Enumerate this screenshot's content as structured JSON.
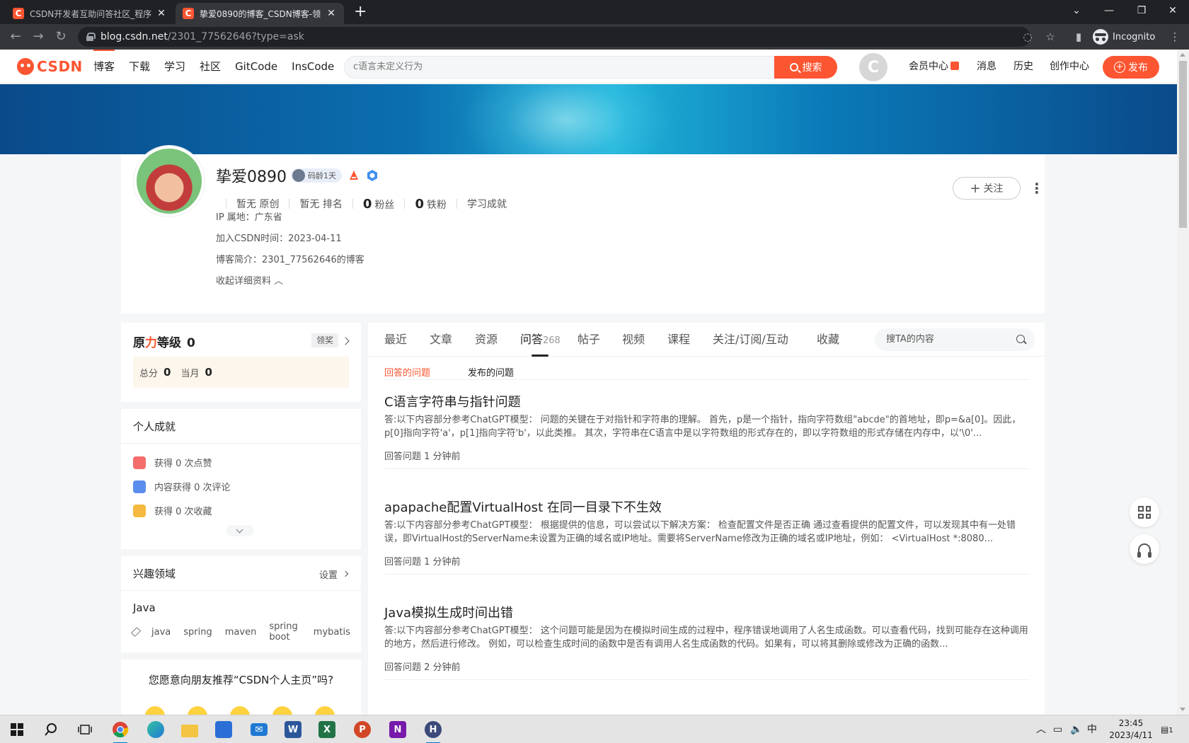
{
  "browser": {
    "tabs": [
      {
        "title": "CSDN开发者互助问答社区_程序",
        "favicon": "C"
      },
      {
        "title": "挚爱0890的博客_CSDN博客-领",
        "favicon": "C"
      }
    ],
    "new_tab": "+",
    "url_host": "blog.csdn.net",
    "url_path": "/2301_77562646?type=ask",
    "incognito_label": "Incognito"
  },
  "header": {
    "logo": "CSDN",
    "nav": [
      "博客",
      "下载",
      "学习",
      "社区",
      "GitCode",
      "InsCode"
    ],
    "search_placeholder": "c语言未定义行为",
    "search_button": "搜索",
    "right_links": [
      "会员中心",
      "消息",
      "历史",
      "创作中心"
    ],
    "publish": "发布",
    "accent_color": "#fc5531"
  },
  "profile": {
    "name": "挚爱0890",
    "code_age": "码龄1天",
    "stats": [
      {
        "value": "暂无",
        "label": "原创"
      },
      {
        "value": "暂无",
        "label": "排名"
      },
      {
        "value": "0",
        "label": "粉丝"
      },
      {
        "value": "0",
        "label": "铁粉"
      },
      {
        "value": "",
        "label": "学习成就"
      }
    ],
    "ip": "IP 属地：广东省",
    "joined": "加入CSDN时间：2023-04-11",
    "intro": "博客简介：2301_77562646的博客",
    "collapse": "收起详细资料",
    "follow": "关注"
  },
  "power": {
    "title_a": "原",
    "title_b": "力",
    "title_c": "等级",
    "level": "0",
    "reward": "领奖",
    "total_label": "总分",
    "total": "0",
    "month_label": "当月",
    "month": "0"
  },
  "achievements": {
    "title": "个人成就",
    "items": [
      "获得 0 次点赞",
      "内容获得 0 次评论",
      "获得 0 次收藏"
    ]
  },
  "interests": {
    "title": "兴趣领域",
    "settings": "设置",
    "field": "Java",
    "tags": [
      "java",
      "spring",
      "maven",
      "spring boot",
      "mybatis"
    ]
  },
  "recommend": {
    "question": "您愿意向朋友推荐“CSDN个人主页”吗?"
  },
  "main": {
    "tabs": [
      {
        "label": "最近",
        "count": ""
      },
      {
        "label": "文章",
        "count": ""
      },
      {
        "label": "资源",
        "count": ""
      },
      {
        "label": "问答",
        "count": "268"
      },
      {
        "label": "帖子",
        "count": ""
      },
      {
        "label": "视频",
        "count": ""
      },
      {
        "label": "课程",
        "count": ""
      },
      {
        "label": "关注/订阅/互动",
        "count": ""
      },
      {
        "label": "收藏",
        "count": ""
      }
    ],
    "search_placeholder": "搜TA的内容",
    "subtabs": [
      "回答的问题",
      "发布的问题"
    ],
    "questions": [
      {
        "title": "C语言字符串与指针问题",
        "answer": "答:以下内容部分参考ChatGPT模型： 问题的关键在于对指针和字符串的理解。 首先，p是一个指针，指向字符数组\"abcde\"的首地址，即p=&a[0]。因此，p[0]指向字符'a'，p[1]指向字符'b'，以此类推。 其次，字符串在C语言中是以字符数组的形式存在的，即以字符数组的形式存储在内存中，以'\\0'...",
        "meta": "回答问题 1 分钟前"
      },
      {
        "title": "apapache配置VirtualHost 在同一目录下不生效",
        "answer": "答:以下内容部分参考ChatGPT模型： 根据提供的信息，可以尝试以下解决方案： 检查配置文件是否正确 通过查看提供的配置文件，可以发现其中有一处错误，即VirtualHost的ServerName未设置为正确的域名或IP地址。需要将ServerName修改为正确的域名或IP地址，例如： <VirtualHost *:8080...",
        "meta": "回答问题 1 分钟前"
      },
      {
        "title": "Java模拟生成时间出错",
        "answer": "答:以下内容部分参考ChatGPT模型： 这个问题可能是因为在模拟时间生成的过程中，程序错误地调用了人名生成函数。可以查看代码，找到可能存在这种调用的地方，然后进行修改。 例如，可以检查生成时间的函数中是否有调用人名生成函数的代码。如果有，可以将其删除或修改为正确的函数...",
        "meta": "回答问题 2 分钟前"
      }
    ]
  },
  "taskbar": {
    "apps": [
      "start-icon",
      "search-icon",
      "task-view-icon",
      "chrome-icon",
      "edge-icon",
      "file-explorer-icon",
      "store-icon",
      "mail-icon",
      "word-icon",
      "excel-icon",
      "powerpoint-icon",
      "onenote-icon",
      "app-icon"
    ],
    "ime": "中",
    "time": "23:45",
    "date": "2023/4/11",
    "notifications": "1"
  }
}
